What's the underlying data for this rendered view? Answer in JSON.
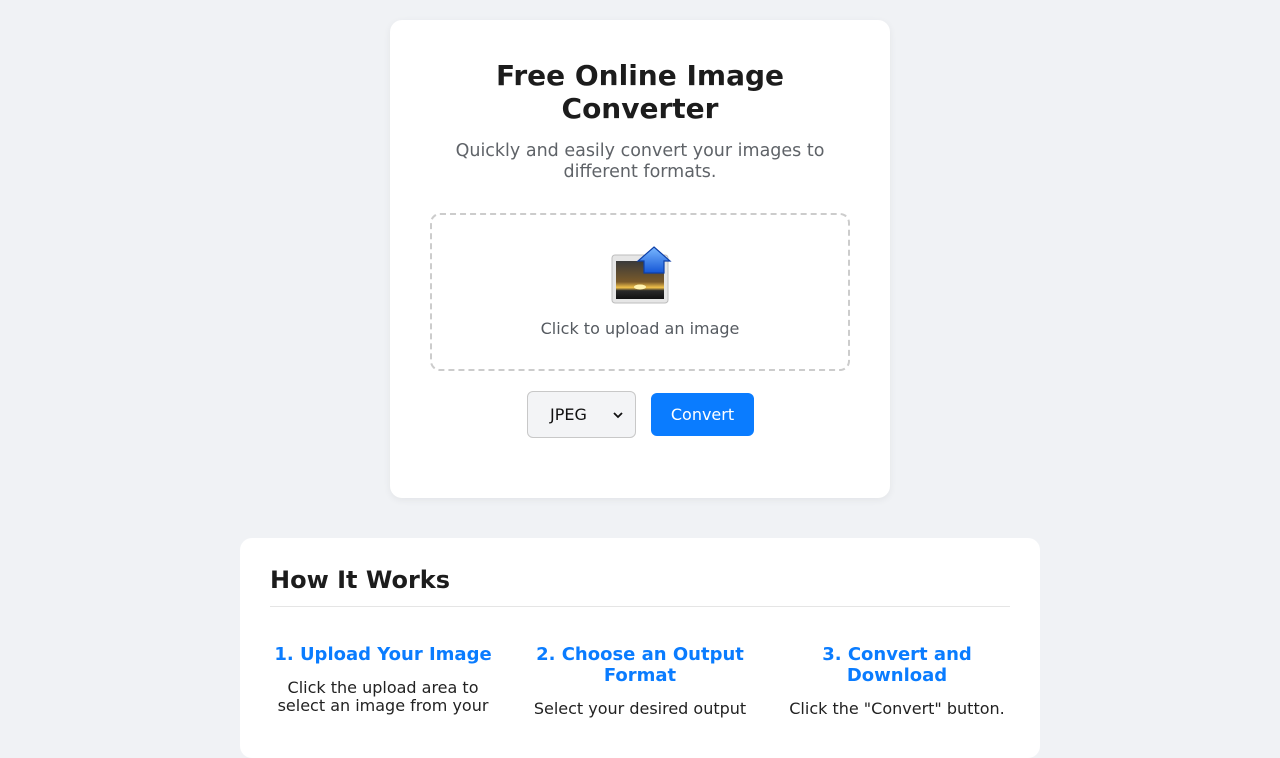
{
  "converter": {
    "title": "Free Online Image Converter",
    "subtitle": "Quickly and easily convert your images to different formats.",
    "upload_label": "Click to upload an image",
    "upload_icon": "image-upload-icon",
    "format_selected": "JPEG",
    "convert_label": "Convert",
    "accent_color": "#0a7cff"
  },
  "how_it_works": {
    "title": "How It Works",
    "steps": [
      {
        "title": "1. Upload Your Image",
        "text": "Click the upload area to select an image from your"
      },
      {
        "title": "2. Choose an Output Format",
        "text": "Select your desired output"
      },
      {
        "title": "3. Convert and Download",
        "text": "Click the \"Convert\" button."
      }
    ]
  }
}
